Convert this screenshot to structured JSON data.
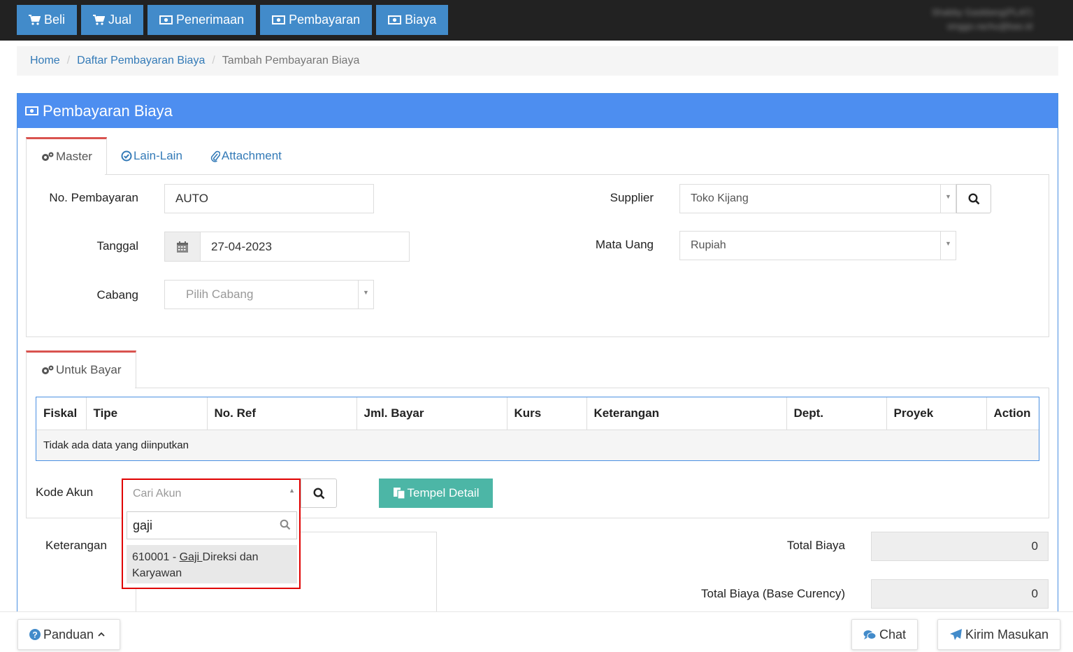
{
  "nav": [
    {
      "label": "Beli",
      "icon": "cart-icon"
    },
    {
      "label": "Jual",
      "icon": "cart-icon"
    },
    {
      "label": "Penerimaan",
      "icon": "money-icon"
    },
    {
      "label": "Pembayaran",
      "icon": "money-icon"
    },
    {
      "label": "Biaya",
      "icon": "money-icon"
    }
  ],
  "user": {
    "line1": "Shabby Gaskberg(PLAT)",
    "line2": "singgo.rachu@bas.id"
  },
  "breadcrumb": {
    "home": "Home",
    "list": "Daftar Pembayaran Biaya",
    "current": "Tambah Pembayaran Biaya",
    "sep": "/"
  },
  "panel": {
    "title": "Pembayaran Biaya"
  },
  "tabs": {
    "master": "Master",
    "lain": "Lain-Lain",
    "attachment": "Attachment"
  },
  "form": {
    "no_label": "No. Pembayaran",
    "no_value": "AUTO",
    "tanggal_label": "Tanggal",
    "tanggal_value": "27-04-2023",
    "cabang_label": "Cabang",
    "cabang_placeholder": "Pilih Cabang",
    "supplier_label": "Supplier",
    "supplier_value": "Toko Kijang",
    "mata_uang_label": "Mata Uang",
    "mata_uang_value": "Rupiah"
  },
  "untuk_bayar": {
    "tab": "Untuk Bayar",
    "columns": [
      "Fiskal",
      "Tipe",
      "No. Ref",
      "Jml. Bayar",
      "Kurs",
      "Keterangan",
      "Dept.",
      "Proyek",
      "Action"
    ],
    "empty": "Tidak ada data yang diinputkan"
  },
  "kode_akun": {
    "label": "Kode Akun",
    "placeholder": "Cari Akun",
    "search_value": "gaji",
    "result_code": "610001 - ",
    "result_match": "Gaji ",
    "result_rest": "Direksi dan",
    "result_line2": "Karyawan"
  },
  "tempel": "Tempel Detail",
  "keterangan_label": "Keterangan",
  "totals": {
    "biaya_label": "Total Biaya",
    "biaya_value": "0",
    "base_label": "Total Biaya (Base Curency)",
    "base_value": "0"
  },
  "bottom": {
    "panduan": "Panduan",
    "chat": "Chat",
    "kirim": "Kirim Masukan"
  },
  "colors": {
    "topbar": "#222222",
    "nav": "#428bca",
    "panel": "#4d8ef0",
    "teal": "#4cb6a6",
    "highlight": "#e00000"
  }
}
